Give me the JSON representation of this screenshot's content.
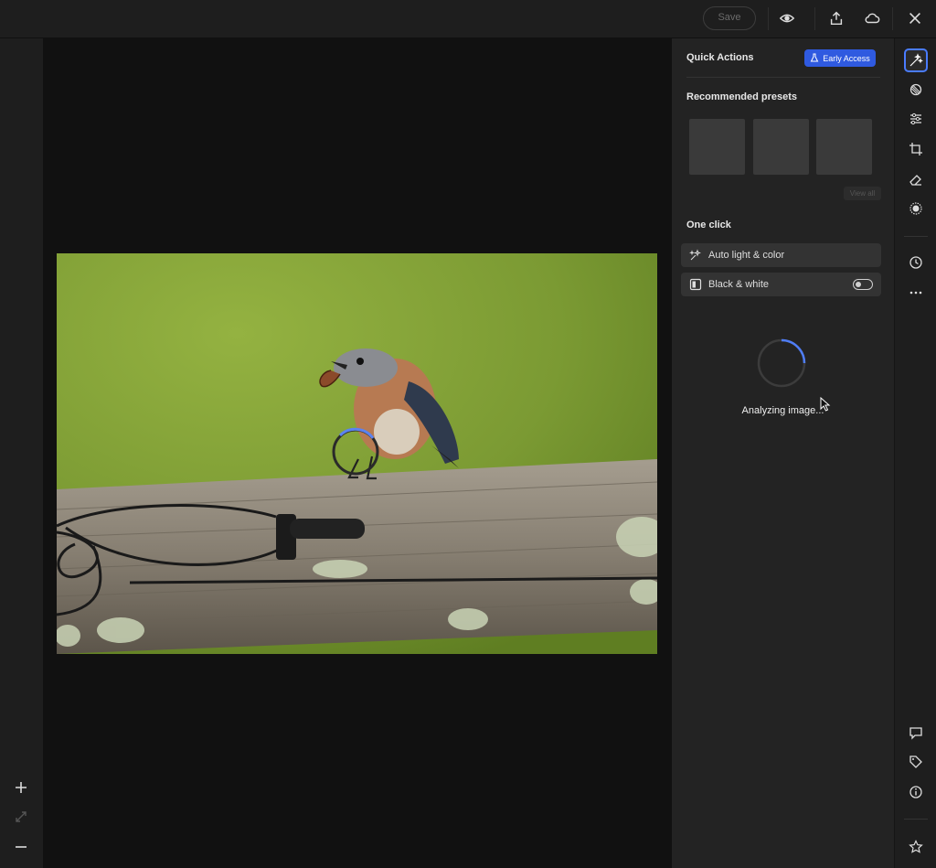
{
  "toolbar": {
    "save_label": "Save",
    "icons": [
      "eye-icon",
      "share-icon",
      "cloud-icon",
      "close-icon"
    ]
  },
  "left_rail": {
    "icons": [
      "zoom-in-icon",
      "fit-screen-icon",
      "zoom-out-icon"
    ]
  },
  "quick_actions": {
    "title": "Quick Actions",
    "badge": "Early Access",
    "badge_color": "#2f5ae0",
    "recommended_title": "Recommended presets",
    "view_all": "View all",
    "one_click_title": "One click",
    "items": [
      {
        "label": "Auto light & color",
        "icon": "auto-light-icon"
      },
      {
        "label": "Black & white",
        "icon": "black-white-icon",
        "toggle": false
      }
    ],
    "status": "Analyzing image..."
  },
  "right_rail": {
    "tools": [
      "quick-actions-icon",
      "presets-icon",
      "adjust-icon",
      "crop-icon",
      "eraser-icon",
      "mask-icon",
      "history-icon",
      "more-icon"
    ],
    "bottom": [
      "comment-icon",
      "tag-icon",
      "info-icon",
      "star-icon"
    ],
    "accent": "#4a7cff"
  }
}
